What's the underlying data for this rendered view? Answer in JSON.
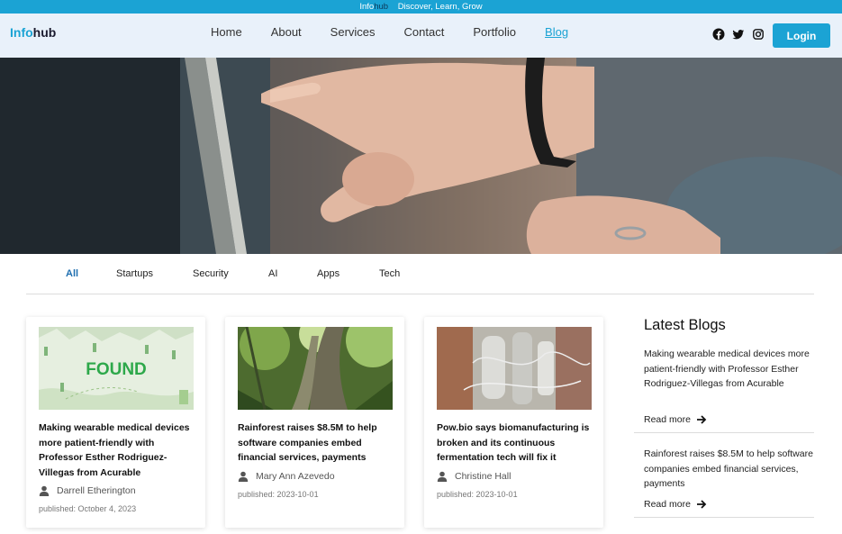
{
  "topbar": {
    "brand_info": "Info",
    "brand_hub": "hub",
    "tagline": "Discover, Learn, Grow"
  },
  "header": {
    "logo_info": "Info",
    "logo_hub": "hub",
    "menu": [
      "Home",
      "About",
      "Services",
      "Contact",
      "Portfolio",
      "Blog"
    ],
    "active_menu": "Blog",
    "social_icons": [
      "facebook-icon",
      "twitter-icon",
      "instagram-icon"
    ],
    "login_label": "Login"
  },
  "categories": {
    "items": [
      "All",
      "Startups",
      "Security",
      "AI",
      "Apps",
      "Tech"
    ],
    "active": "All"
  },
  "cards": [
    {
      "image_text": "FOUND",
      "title": "Making wearable medical devices more patient-friendly with Professor Esther Rodriguez-Villegas from Acurable",
      "author": "Darrell Etherington",
      "date": "published: October 4, 2023"
    },
    {
      "title": "Rainforest raises $8.5M to help software companies embed financial services, payments",
      "author": "Mary Ann Azevedo",
      "date": "published: 2023-10-01"
    },
    {
      "title": "Pow.bio says biomanufacturing is broken and its continuous fermentation tech will fix it",
      "author": "Christine Hall",
      "date": "published: 2023-10-01"
    }
  ],
  "sidebar": {
    "title": "Latest Blogs",
    "items": [
      {
        "title": "Making wearable medical devices more patient-friendly with Professor Esther Rodriguez-Villegas from Acurable",
        "more": "Read more"
      },
      {
        "title": "Rainforest raises $8.5M to help software companies embed financial services, payments",
        "more": "Read more"
      }
    ]
  },
  "colors": {
    "accent": "#1ba3d4",
    "nav_bg": "#e9f1fa",
    "active_category": "#1f6fb0"
  }
}
